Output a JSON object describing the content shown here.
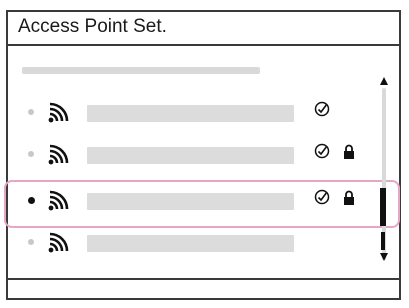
{
  "screen": {
    "title": "Access Point Set."
  },
  "access_points": [
    {
      "signal_icon": "wifi-signal-icon",
      "status_icon": "check-circle-icon",
      "locked": false,
      "selected": false
    },
    {
      "signal_icon": "wifi-signal-icon",
      "status_icon": "check-circle-icon",
      "locked": true,
      "selected": false
    },
    {
      "signal_icon": "wifi-signal-icon",
      "status_icon": "check-circle-icon",
      "locked": true,
      "selected": true
    },
    {
      "signal_icon": "wifi-signal-icon",
      "status_icon": "",
      "locked": false,
      "selected": false
    }
  ],
  "colors": {
    "highlight": "#e6a6c4",
    "frame": "#3a3a3a",
    "placeholder": "#dcdcdc"
  }
}
